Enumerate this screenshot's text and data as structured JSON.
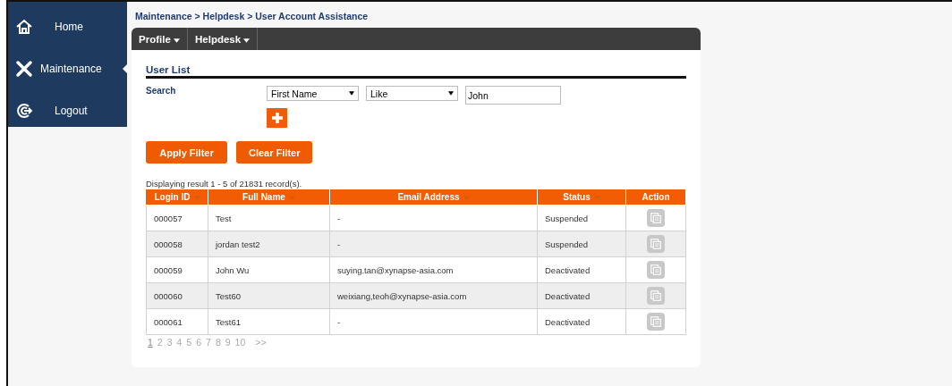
{
  "sidebar": {
    "items": [
      {
        "label": "Home",
        "kind": "home",
        "selected": false
      },
      {
        "label": "Maintenance",
        "kind": "tools",
        "selected": true
      },
      {
        "label": "Logout",
        "kind": "logout",
        "selected": false
      }
    ]
  },
  "breadcrumb": "Maintenance > Helpdesk > User Account Assistance",
  "menu": [
    "Profile",
    "Helpdesk"
  ],
  "section_title": "User List",
  "search": {
    "label": "Search",
    "field": "First Name",
    "operator": "Like",
    "value": "John"
  },
  "buttons": [
    "Apply Filter",
    "Clear Filter"
  ],
  "result_text": "Displaying result 1 - 5 of 21831 record(s).",
  "table": {
    "columns": [
      {
        "label": "Login ID",
        "sortable": true
      },
      {
        "label": "Full Name",
        "sortable": true
      },
      {
        "label": "Email Address",
        "sortable": true
      },
      {
        "label": "Status",
        "sortable": true
      },
      {
        "label": "Action",
        "sortable": false
      }
    ],
    "rows": [
      [
        "000057",
        "Test",
        "-",
        "Suspended"
      ],
      [
        "000058",
        "jordan test2",
        "-",
        "Suspended"
      ],
      [
        "000059",
        "John Wu",
        "suying.tan@xynapse-asia.com",
        "Deactivated"
      ],
      [
        "000060",
        "Test60",
        "weixiang,teoh@xynapse-asia.com",
        "Deactivated"
      ],
      [
        "000061",
        "Test61",
        "-",
        "Deactivated"
      ]
    ]
  },
  "pagination": [
    {
      "label": "1",
      "selected": true
    },
    {
      "label": "2",
      "selected": false
    },
    {
      "label": "3",
      "selected": false
    },
    {
      "label": "4",
      "selected": false
    },
    {
      "label": "5",
      "selected": false
    },
    {
      "label": "6",
      "selected": false
    },
    {
      "label": "7",
      "selected": false
    },
    {
      "label": "8",
      "selected": false
    },
    {
      "label": "9",
      "selected": false
    },
    {
      "label": "10",
      "selected": false
    },
    {
      "label": ">>",
      "selected": false
    }
  ]
}
